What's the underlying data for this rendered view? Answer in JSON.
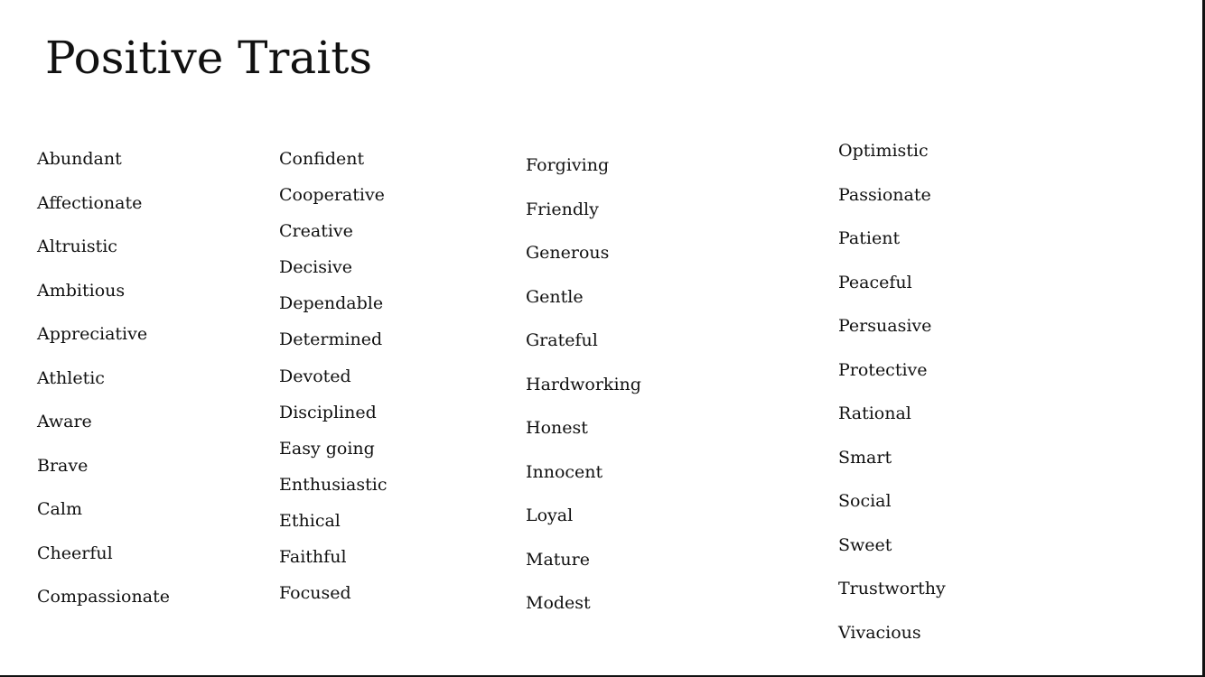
{
  "title": "Positive Traits",
  "columns": [
    [
      "Abundant",
      "Affectionate",
      "Altruistic",
      "Ambitious",
      "Appreciative",
      "Athletic",
      "Aware",
      "Brave",
      "Calm",
      "Cheerful",
      "Compassionate"
    ],
    [
      "Confident",
      "Cooperative",
      "Creative",
      "Decisive",
      "Dependable",
      "Determined",
      "Devoted",
      "Disciplined",
      "Easy going",
      "Enthusiastic",
      "Ethical",
      "Faithful",
      "Focused"
    ],
    [
      "Forgiving",
      "Friendly",
      "Generous",
      "Gentle",
      "Grateful",
      "Hardworking",
      "Honest",
      "Innocent",
      "Loyal",
      "Mature",
      "Modest"
    ],
    [
      "Optimistic",
      "Passionate",
      "Patient",
      "Peaceful",
      "Persuasive",
      "Protective",
      "Rational",
      "Smart",
      "Social",
      "Sweet",
      "Trustworthy",
      "Vivacious"
    ]
  ]
}
